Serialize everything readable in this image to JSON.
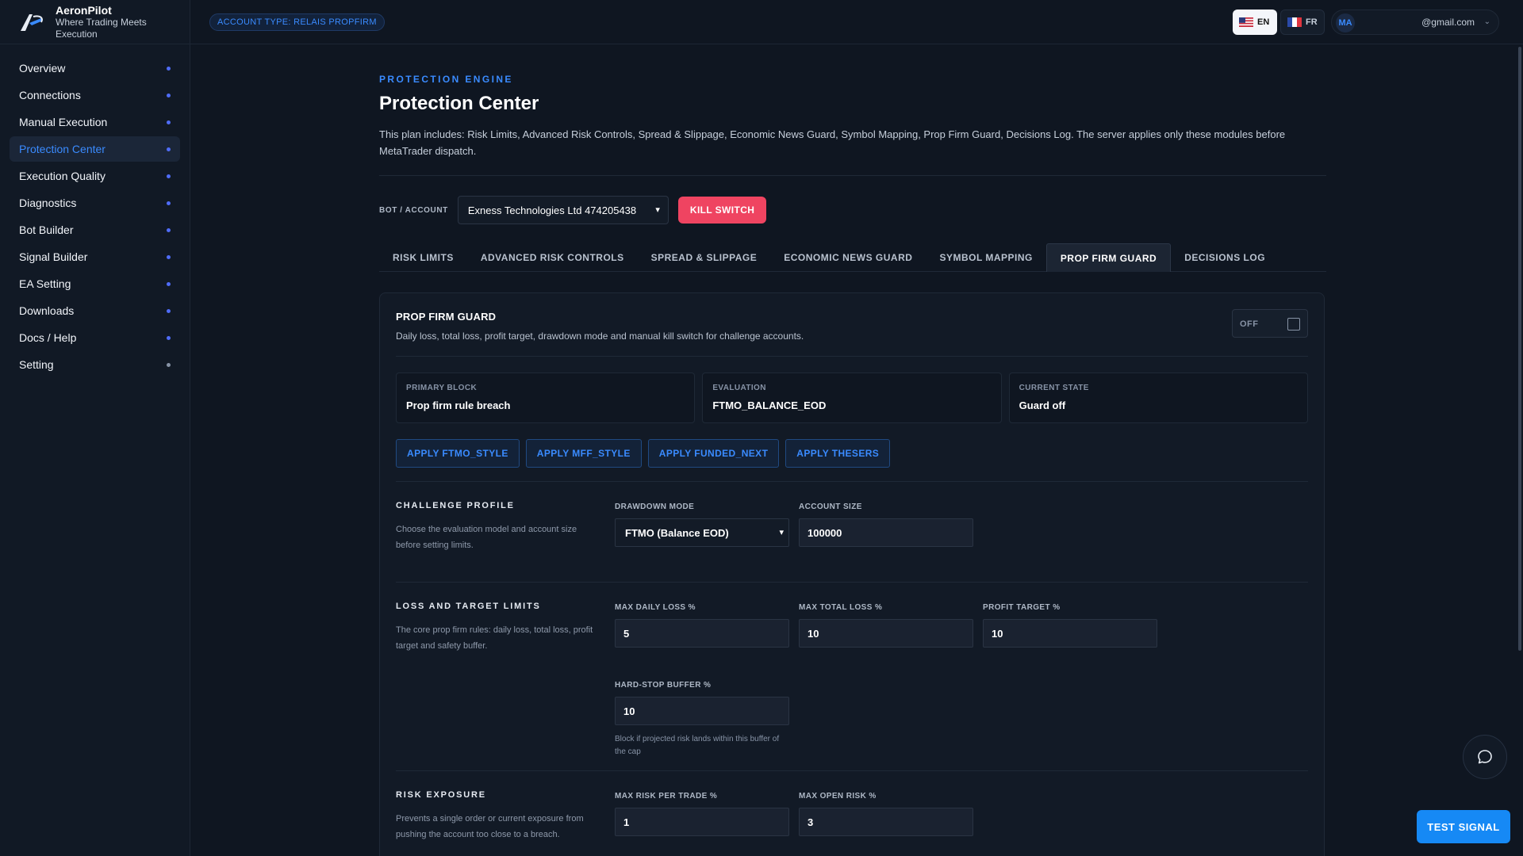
{
  "brand": {
    "name": "AeronPilot",
    "tagline": "Where Trading Meets Execution"
  },
  "sidebar": {
    "items": [
      {
        "label": "Overview"
      },
      {
        "label": "Connections"
      },
      {
        "label": "Manual Execution"
      },
      {
        "label": "Protection Center",
        "active": true
      },
      {
        "label": "Execution Quality"
      },
      {
        "label": "Diagnostics"
      },
      {
        "label": "Bot Builder"
      },
      {
        "label": "Signal Builder"
      },
      {
        "label": "EA Setting"
      },
      {
        "label": "Downloads"
      },
      {
        "label": "Docs / Help"
      },
      {
        "label": "Setting"
      }
    ]
  },
  "topbar": {
    "account_type": "ACCOUNT TYPE: RELAIS PROPFIRM",
    "lang_en": "EN",
    "lang_fr": "FR",
    "avatar": "MA",
    "email": "@gmail.com"
  },
  "page": {
    "eyebrow": "PROTECTION ENGINE",
    "title": "Protection Center",
    "description": "This plan includes: Risk Limits, Advanced Risk Controls, Spread & Slippage, Economic News Guard, Symbol Mapping, Prop Firm Guard, Decisions Log. The server applies only these modules before MetaTrader dispatch."
  },
  "account_row": {
    "label": "BOT / ACCOUNT",
    "selected": "Exness Technologies Ltd 474205438",
    "kill_switch": "KILL SWITCH"
  },
  "tabs": [
    {
      "label": "RISK LIMITS"
    },
    {
      "label": "ADVANCED RISK CONTROLS"
    },
    {
      "label": "SPREAD & SLIPPAGE"
    },
    {
      "label": "ECONOMIC NEWS GUARD"
    },
    {
      "label": "SYMBOL MAPPING"
    },
    {
      "label": "PROP FIRM GUARD",
      "active": true
    },
    {
      "label": "DECISIONS LOG"
    }
  ],
  "card": {
    "title": "PROP FIRM GUARD",
    "subtitle": "Daily loss, total loss, profit target, drawdown mode and manual kill switch for challenge accounts.",
    "toggle_label": "OFF",
    "stats": [
      {
        "key": "PRIMARY BLOCK",
        "value": "Prop firm rule breach"
      },
      {
        "key": "EVALUATION",
        "value": "FTMO_BALANCE_EOD"
      },
      {
        "key": "CURRENT STATE",
        "value": "Guard off"
      }
    ],
    "presets": [
      "APPLY FTMO_STYLE",
      "APPLY MFF_STYLE",
      "APPLY FUNDED_NEXT",
      "APPLY THESERS"
    ],
    "challenge": {
      "title": "CHALLENGE PROFILE",
      "desc": "Choose the evaluation model and account size before setting limits.",
      "drawdown_label": "DRAWDOWN MODE",
      "drawdown_value": "FTMO (Balance EOD)",
      "size_label": "ACCOUNT SIZE",
      "size_value": "100000"
    },
    "limits": {
      "title": "LOSS AND TARGET LIMITS",
      "desc": "The core prop firm rules: daily loss, total loss, profit target and safety buffer.",
      "daily_label": "MAX DAILY LOSS %",
      "daily_value": "5",
      "total_label": "MAX TOTAL LOSS %",
      "total_value": "10",
      "target_label": "PROFIT TARGET %",
      "target_value": "10",
      "buffer_label": "HARD-STOP BUFFER %",
      "buffer_value": "10",
      "buffer_hint": "Block if projected risk lands within this buffer of the cap"
    },
    "exposure": {
      "title": "RISK EXPOSURE",
      "desc": "Prevents a single order or current exposure from pushing the account too close to a breach.",
      "per_trade_label": "MAX RISK PER TRADE %",
      "per_trade_value": "1",
      "open_label": "MAX OPEN RISK %",
      "open_value": "3"
    }
  },
  "floating": {
    "test_signal": "TEST SIGNAL"
  },
  "colors": {
    "accent": "#3a8bff",
    "danger": "#ef4461",
    "bg": "#0f1621",
    "panel": "#121a26"
  }
}
